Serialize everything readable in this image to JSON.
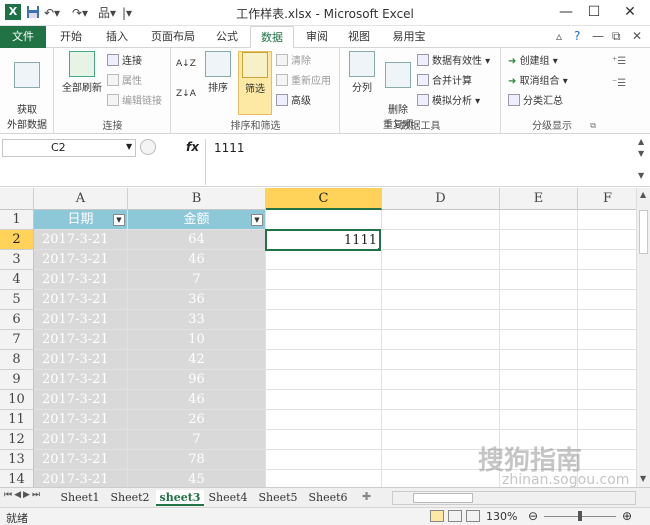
{
  "title_bar": {
    "app_logo": "X",
    "window_title": "工作样表.xlsx - Microsoft Excel",
    "quick_access": [
      "save-icon",
      "undo-icon",
      "redo-icon",
      "workbook-icon"
    ],
    "buttons": {
      "minimize": "—",
      "restore": "☐",
      "close": "✕"
    }
  },
  "ribbon_tabs": [
    "文件",
    "开始",
    "插入",
    "页面布局",
    "公式",
    "数据",
    "审阅",
    "视图",
    "易用宝"
  ],
  "ribbon": {
    "external_data": "获取\n外部数据",
    "connections_group": {
      "refresh_all": "全部刷新",
      "connect": "连接",
      "properties": "属性",
      "edit_links": "编辑链接",
      "label": "连接"
    },
    "sort_filter_group": {
      "sort_az": "A↓Z",
      "sort_za": "Z↓A",
      "sort": "排序",
      "filter": "筛选",
      "clear": "清除",
      "reapply": "重新应用",
      "advanced": "高级",
      "label": "排序和筛选"
    },
    "data_tools_group": {
      "text_to_columns": "分列",
      "remove_duplicates": "删除\n重复项",
      "data_validation": "数据有效性 ▾",
      "consolidate": "合并计算",
      "what_if": "模拟分析 ▾",
      "label": "数据工具"
    },
    "outline_group": {
      "group": "创建组 ▾",
      "ungroup": "取消组合 ▾",
      "subtotal": "分类汇总",
      "label": "分级显示"
    }
  },
  "formula_bar": {
    "name_box": "C2",
    "fx": "fx",
    "formula": "1111"
  },
  "grid": {
    "columns": [
      "A",
      "B",
      "C",
      "D",
      "E",
      "F"
    ],
    "rows": [
      "1",
      "2",
      "3",
      "4",
      "5",
      "6",
      "7",
      "8",
      "9",
      "10",
      "11",
      "12",
      "13",
      "14"
    ],
    "header_row": {
      "A": "日期",
      "B": "金额"
    },
    "data": [
      {
        "date": "2017-3-21",
        "amount": "64"
      },
      {
        "date": "2017-3-21",
        "amount": "46"
      },
      {
        "date": "2017-3-21",
        "amount": "7"
      },
      {
        "date": "2017-3-21",
        "amount": "36"
      },
      {
        "date": "2017-3-21",
        "amount": "33"
      },
      {
        "date": "2017-3-21",
        "amount": "10"
      },
      {
        "date": "2017-3-21",
        "amount": "42"
      },
      {
        "date": "2017-3-21",
        "amount": "96"
      },
      {
        "date": "2017-3-21",
        "amount": "46"
      },
      {
        "date": "2017-3-21",
        "amount": "26"
      },
      {
        "date": "2017-3-21",
        "amount": "7"
      },
      {
        "date": "2017-3-21",
        "amount": "78"
      },
      {
        "date": "2017-3-21",
        "amount": "45"
      }
    ],
    "active_cell": {
      "ref": "C2",
      "value": "1111"
    }
  },
  "sheet_tabs": [
    "Sheet1",
    "Sheet2",
    "sheet3",
    "Sheet4",
    "Sheet5",
    "Sheet6"
  ],
  "active_sheet": "sheet3",
  "status_bar": {
    "status": "就绪",
    "zoom": "130%"
  },
  "watermark": {
    "text": "搜狗指南",
    "url": "zhinan.sogou.com"
  },
  "colors": {
    "accent": "#217346",
    "header_fill": "#8cc8d8",
    "data_fill": "#d9d9d9",
    "selected_header": "#ffd35a"
  }
}
